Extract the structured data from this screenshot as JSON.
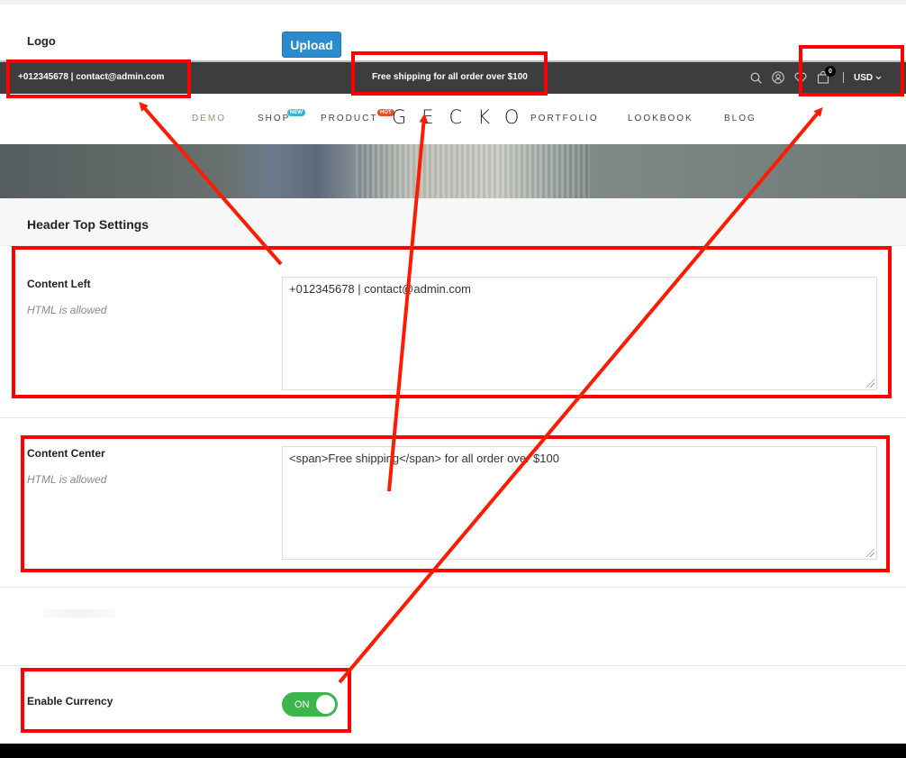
{
  "admin": {
    "logo_label": "Logo",
    "upload_label": "Upload"
  },
  "preview": {
    "topbar": {
      "left_text": "+012345678 | contact@admin.com",
      "center_text": "Free shipping for all order over $100",
      "icons": [
        "search-icon",
        "user-icon",
        "heart-icon",
        "cart-icon"
      ],
      "cart_count": "0",
      "currency": "USD"
    },
    "nav": {
      "items": [
        "DEMO",
        "SHOP",
        "PRODUCT",
        "PORTFOLIO",
        "LOOKBOOK",
        "BLOG"
      ],
      "badge_new": "NEW",
      "badge_hot": "HOT",
      "brand": "GECKO"
    }
  },
  "settings": {
    "section_title": "Header Top Settings",
    "content_left": {
      "label": "Content Left",
      "hint": "HTML is allowed",
      "value": "+012345678 | contact@admin.com"
    },
    "content_center": {
      "label": "Content Center",
      "hint": "HTML is allowed",
      "value": "<span>Free shipping</span> for all order over $100"
    },
    "enable_currency": {
      "label": "Enable Currency",
      "state": "ON"
    }
  },
  "colors": {
    "annotation": "#ff0000",
    "topbar_bg": "#3d3d3d",
    "upload_button": "#2a8ccf",
    "toggle_on": "#3cb54a",
    "nav_active": "#a4876a"
  }
}
